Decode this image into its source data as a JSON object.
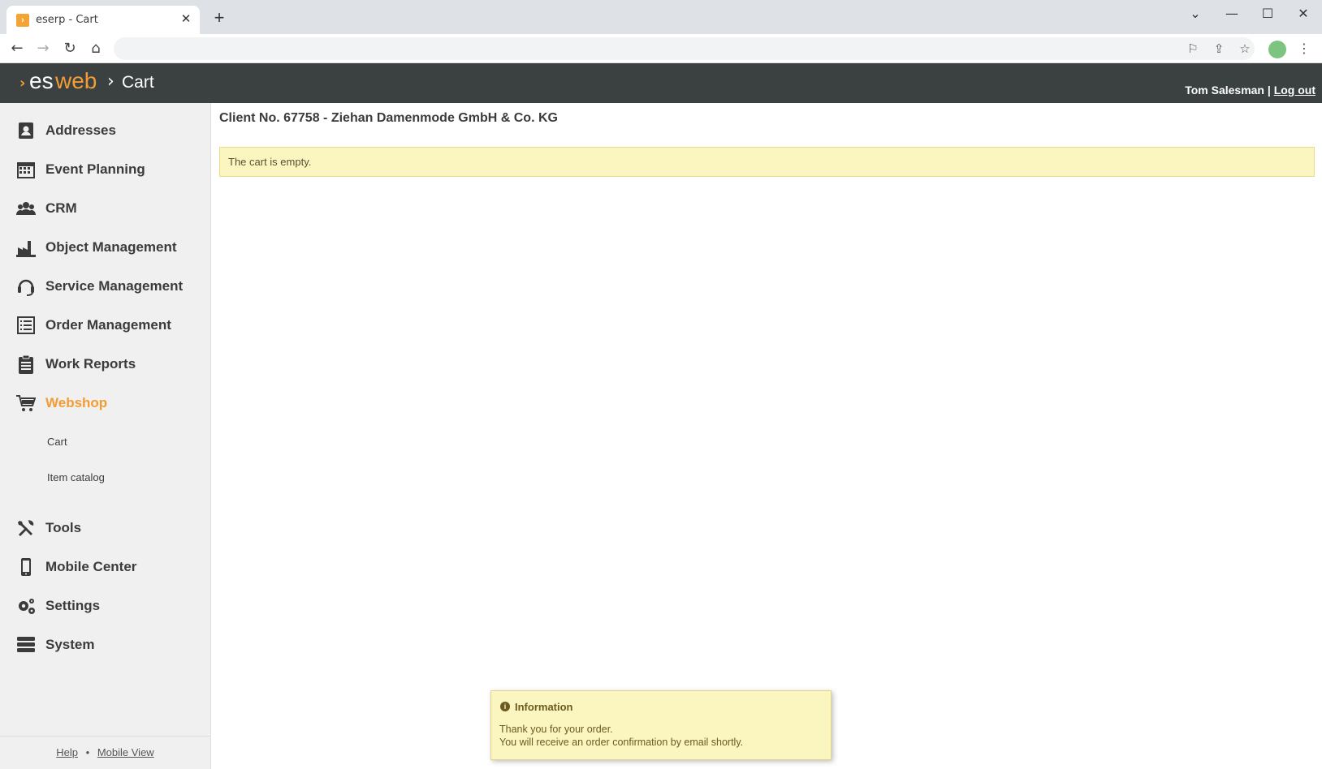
{
  "browser": {
    "tab_title": "eserp - Cart",
    "tab_close": "✕",
    "new_tab": "+",
    "window_controls": [
      "⌄",
      "—",
      "☐",
      "✕"
    ]
  },
  "header": {
    "logo_arrow": "›",
    "logo_es": "es",
    "logo_web": "web",
    "breadcrumb_sep": "›",
    "breadcrumb": "Cart",
    "user_name": "Tom Salesman",
    "separator": "|",
    "logout": "Log out"
  },
  "sidebar": {
    "items": [
      {
        "label": "Addresses",
        "icon": "address-book-icon"
      },
      {
        "label": "Event Planning",
        "icon": "calendar-icon"
      },
      {
        "label": "CRM",
        "icon": "users-icon"
      },
      {
        "label": "Object Management",
        "icon": "factory-icon"
      },
      {
        "label": "Service Management",
        "icon": "headset-icon"
      },
      {
        "label": "Order Management",
        "icon": "list-icon"
      },
      {
        "label": "Work Reports",
        "icon": "clipboard-icon"
      },
      {
        "label": "Webshop",
        "icon": "cart-icon"
      },
      {
        "label": "Tools",
        "icon": "tools-icon"
      },
      {
        "label": "Mobile Center",
        "icon": "phone-icon"
      },
      {
        "label": "Settings",
        "icon": "gears-icon"
      },
      {
        "label": "System",
        "icon": "server-icon"
      }
    ],
    "webshop_sub": [
      "Cart",
      "Item catalog"
    ],
    "footer": {
      "help": "Help",
      "dot": "•",
      "mobile_view": "Mobile View"
    }
  },
  "main": {
    "client_title": "Client No. 67758 - Ziehan Damenmode GmbH & Co. KG",
    "notice": "The cart is empty."
  },
  "toast": {
    "title": "Information",
    "line1": "Thank you for your order.",
    "line2": "You will receive an order confirmation by email shortly."
  },
  "colors": {
    "accent": "#f39c34",
    "header_bg": "#3b4040",
    "notice_bg": "#fbf5c0"
  }
}
